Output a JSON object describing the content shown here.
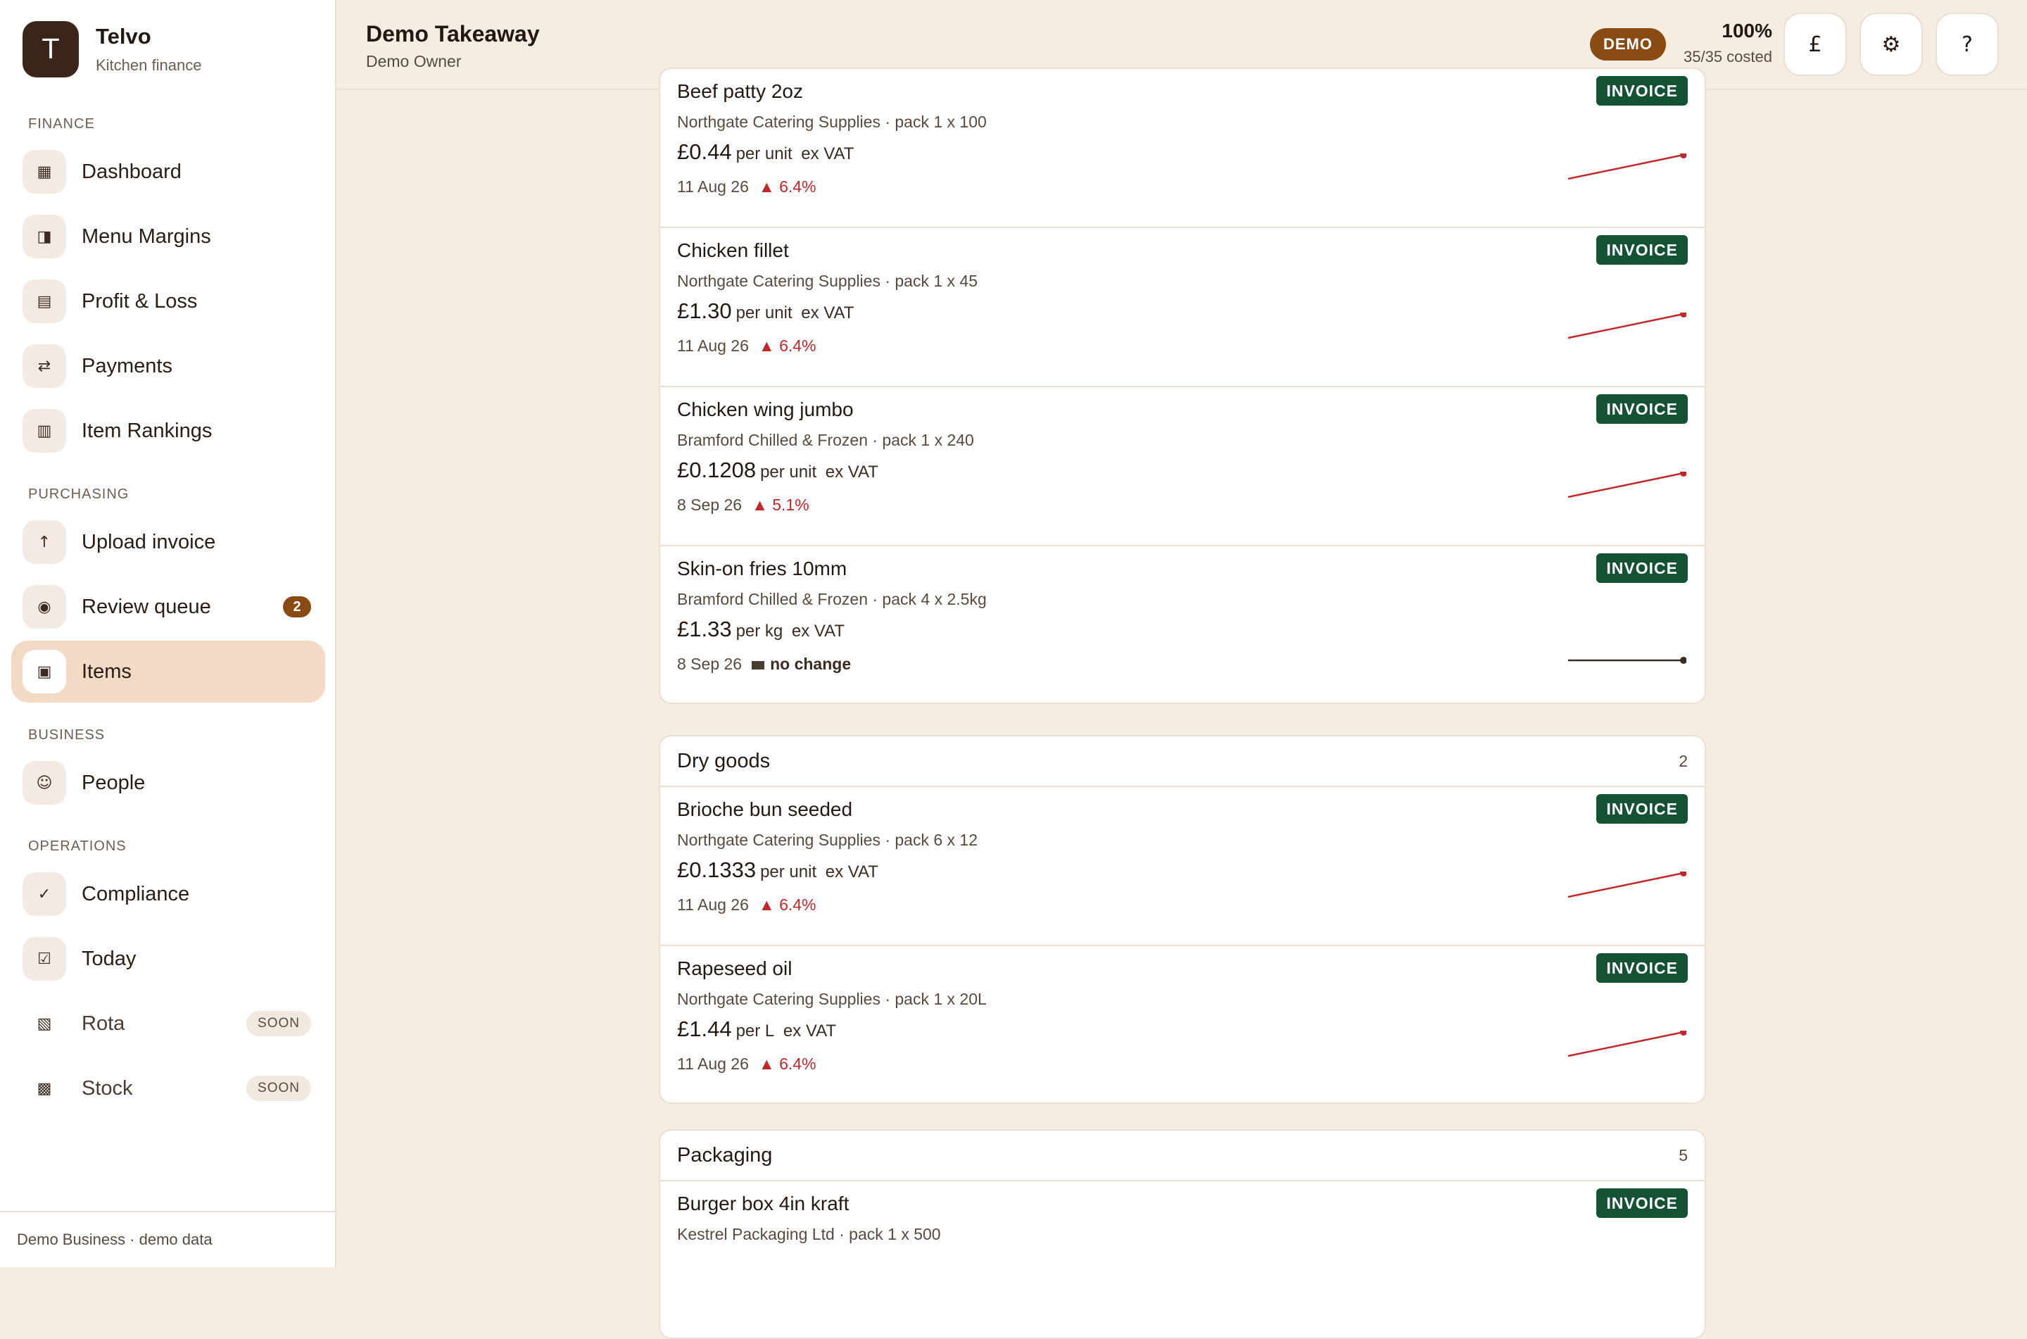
{
  "brand": {
    "logo_letter": "T",
    "name": "Telvo",
    "subtitle": "Kitchen finance"
  },
  "sidebar": {
    "sections": {
      "finance": "FINANCE",
      "purchasing": "PURCHASING",
      "business": "BUSINESS",
      "operations": "OPERATIONS"
    },
    "items": {
      "dashboard": {
        "label": "Dashboard",
        "icon": "dashboard-icon",
        "glyph": "▦"
      },
      "menu_margins": {
        "label": "Menu Margins",
        "icon": "margins-icon",
        "glyph": "◨"
      },
      "profit_loss": {
        "label": "Profit & Loss",
        "icon": "ledger-icon",
        "glyph": "▤"
      },
      "payments": {
        "label": "Payments",
        "icon": "transfer-icon",
        "glyph": "⇄"
      },
      "item_rankings": {
        "label": "Item Rankings",
        "icon": "rankings-icon",
        "glyph": "▥"
      },
      "upload_invoice": {
        "label": "Upload invoice",
        "icon": "upload-icon",
        "glyph": "↑"
      },
      "review_queue": {
        "label": "Review queue",
        "icon": "review-icon",
        "glyph": "◉",
        "badge": "2"
      },
      "items": {
        "label": "Items",
        "icon": "items-icon",
        "glyph": "▣"
      },
      "people": {
        "label": "People",
        "icon": "people-icon",
        "glyph": "☺"
      },
      "compliance": {
        "label": "Compliance",
        "icon": "check-icon",
        "glyph": "✓"
      },
      "today": {
        "label": "Today",
        "icon": "checkbox-icon",
        "glyph": "☑"
      },
      "rota": {
        "label": "Rota",
        "icon": "rota-icon",
        "glyph": "▧",
        "badge": "SOON"
      },
      "stock": {
        "label": "Stock",
        "icon": "stock-icon",
        "glyph": "▩",
        "badge": "SOON"
      }
    },
    "footer": "Demo Business · demo data"
  },
  "header": {
    "title": "Demo Takeaway",
    "subtitle": "Demo Owner",
    "demo_badge": "DEMO",
    "costed_percent": "100%",
    "costed_count": "35/35 costed",
    "buttons": {
      "currency": "£",
      "settings": "⚙",
      "help": "?"
    }
  },
  "colors": {
    "accent": "#8a4b12",
    "invoice_tag": "#145234",
    "price_up": "#c0282a",
    "active_nav": "#f2dac4"
  },
  "groups": [
    {
      "title": "",
      "count": "",
      "items": [
        {
          "name": "Beef patty 2oz",
          "supplier": "Northgate Catering Supplies · pack 1 x 100",
          "price": "£0.44",
          "unit": "per unit",
          "vat": "ex VAT",
          "date": "11 Aug 26",
          "change": "6.4%",
          "trend": "up",
          "tag": "INVOICE"
        },
        {
          "name": "Chicken fillet",
          "supplier": "Northgate Catering Supplies · pack 1 x 45",
          "price": "£1.30",
          "unit": "per unit",
          "vat": "ex VAT",
          "date": "11 Aug 26",
          "change": "6.4%",
          "trend": "up",
          "tag": "INVOICE"
        },
        {
          "name": "Chicken wing jumbo",
          "supplier": "Bramford Chilled & Frozen · pack 1 x 240",
          "price": "£0.1208",
          "unit": "per unit",
          "vat": "ex VAT",
          "date": "8 Sep 26",
          "change": "5.1%",
          "trend": "up",
          "tag": "INVOICE"
        },
        {
          "name": "Skin-on fries 10mm",
          "supplier": "Bramford Chilled & Frozen · pack 4 x 2.5kg",
          "price": "£1.33",
          "unit": "per kg",
          "vat": "ex VAT",
          "date": "8 Sep 26",
          "change": "no change",
          "trend": "flat",
          "tag": "INVOICE"
        }
      ]
    },
    {
      "title": "Dry goods",
      "count": "2",
      "items": [
        {
          "name": "Brioche bun seeded",
          "supplier": "Northgate Catering Supplies · pack 6 x 12",
          "price": "£0.1333",
          "unit": "per unit",
          "vat": "ex VAT",
          "date": "11 Aug 26",
          "change": "6.4%",
          "trend": "up",
          "tag": "INVOICE"
        },
        {
          "name": "Rapeseed oil",
          "supplier": "Northgate Catering Supplies · pack 1 x 20L",
          "price": "£1.44",
          "unit": "per L",
          "vat": "ex VAT",
          "date": "11 Aug 26",
          "change": "6.4%",
          "trend": "up",
          "tag": "INVOICE"
        }
      ]
    },
    {
      "title": "Packaging",
      "count": "5",
      "items": [
        {
          "name": "Burger box 4in kraft",
          "supplier": "Kestrel Packaging Ltd · pack 1 x 500",
          "tag": "INVOICE"
        }
      ]
    }
  ]
}
